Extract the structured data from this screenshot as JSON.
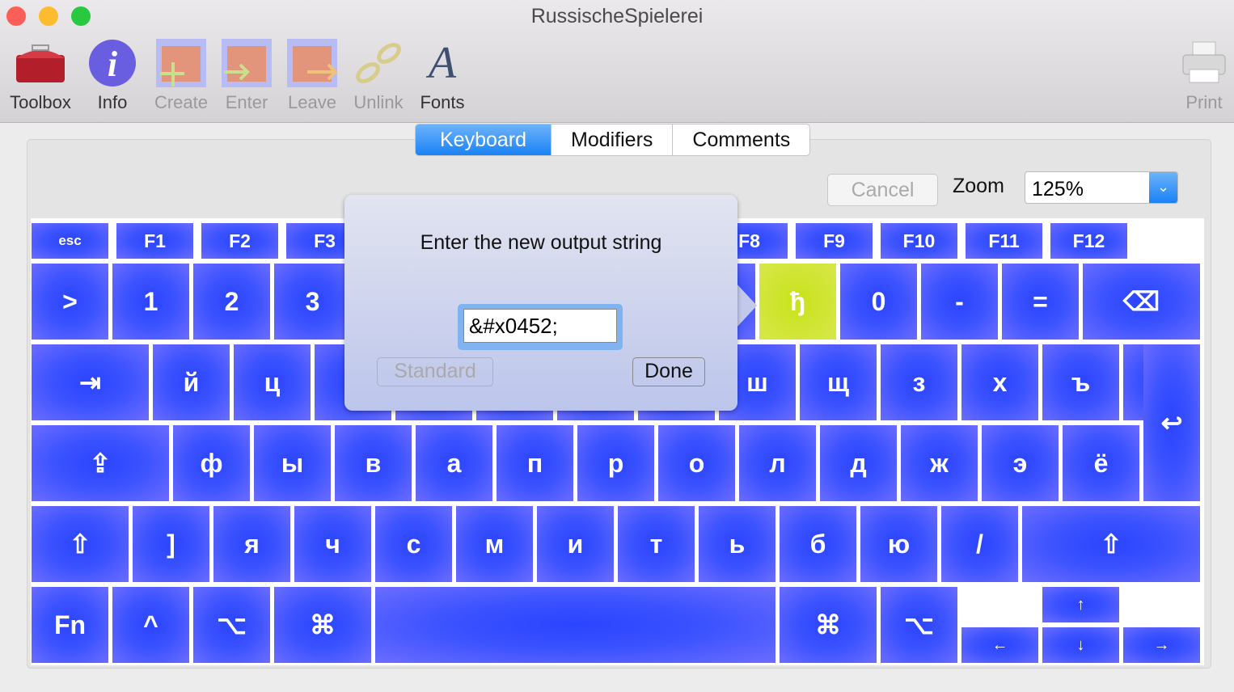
{
  "window": {
    "title": "RussischeSpielerei"
  },
  "toolbar": {
    "toolbox": "Toolbox",
    "info": "Info",
    "create": "Create",
    "enter": "Enter",
    "leave": "Leave",
    "unlink": "Unlink",
    "fonts": "Fonts",
    "print": "Print"
  },
  "tabs": [
    "Keyboard",
    "Modifiers",
    "Comments"
  ],
  "controls": {
    "cancel": "Cancel",
    "zoom_label": "Zoom",
    "zoom_value": "125%"
  },
  "popover": {
    "prompt": "Enter the new output string",
    "value": "&#x0452;",
    "standard": "Standard",
    "done": "Done"
  },
  "colors": {
    "key": "#3a52ff",
    "selected_key": "#cce432",
    "accent": "#1a82f6"
  },
  "keyboard": {
    "rows": [
      [
        "esc",
        "F1",
        "F2",
        "F3",
        "",
        "",
        "",
        "",
        "F8",
        "F9",
        "F10",
        "F11",
        "F12"
      ],
      [
        ">",
        "1",
        "2",
        "3",
        "",
        "",
        "",
        "",
        "",
        "ђ",
        "0",
        "-",
        "=",
        "⌫"
      ],
      [
        "⇥",
        "й",
        "ц",
        "",
        "",
        "",
        "",
        "",
        "ш",
        "щ",
        "з",
        "х",
        "ъ"
      ],
      [
        "⇪",
        "ф",
        "ы",
        "в",
        "а",
        "п",
        "р",
        "о",
        "л",
        "д",
        "ж",
        "э",
        "ё",
        "↩"
      ],
      [
        "⇧",
        "]",
        "я",
        "ч",
        "с",
        "м",
        "и",
        "т",
        "ь",
        "б",
        "ю",
        "/",
        "⇧"
      ],
      [
        "Fn",
        "^",
        "⌥",
        "⌘",
        "",
        "⌘",
        "⌥",
        "↑",
        "←",
        "↓",
        "→"
      ]
    ]
  }
}
